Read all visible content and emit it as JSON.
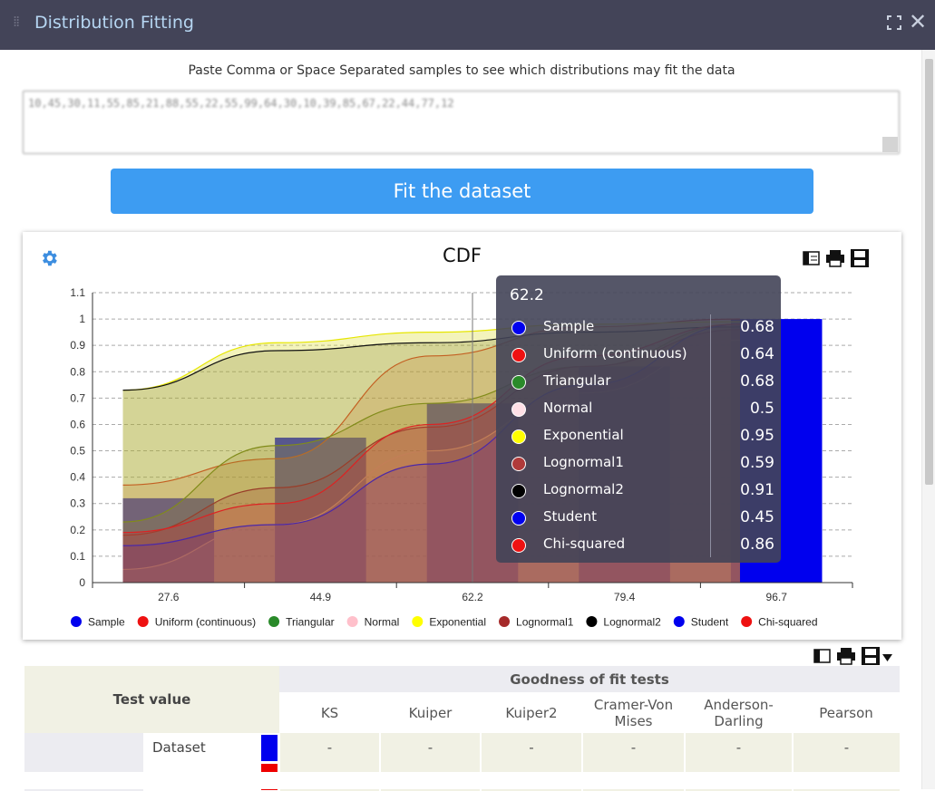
{
  "window": {
    "title": "Distribution Fitting"
  },
  "instruction": "Paste Comma or Space Separated samples to see which distributions may fit the data",
  "samples_text": "10,45,30,11,55,85,21,88,55,22,55,99,64,30,10,39,85,67,22,44,77,12",
  "fit_button": "Fit the dataset",
  "chart_data": {
    "type": "bar",
    "title": "CDF",
    "x_ticks": [
      27.6,
      44.9,
      62.2,
      79.4,
      96.7
    ],
    "ylim": [
      0,
      1.1
    ],
    "y_ticks": [
      "0",
      "0.1",
      "0.2",
      "0.3",
      "0.4",
      "0.5",
      "0.6",
      "0.7",
      "0.8",
      "0.9",
      "1",
      "1.1"
    ],
    "grid": true,
    "legend_position": "bottom",
    "bars": {
      "name": "Sample",
      "values": [
        0.32,
        0.55,
        0.68,
        0.82,
        1.0
      ]
    },
    "series": [
      {
        "name": "Sample",
        "color": "#0000ee",
        "values": [
          0.32,
          0.55,
          0.68,
          0.82,
          1.0
        ]
      },
      {
        "name": "Uniform (continuous)",
        "color": "#ee1111",
        "values": [
          0.37,
          0.47,
          0.86,
          0.97,
          1.0
        ]
      },
      {
        "name": "Triangular",
        "color": "#2a8a2a",
        "values": [
          0.23,
          0.52,
          0.68,
          0.82,
          0.98
        ]
      },
      {
        "name": "Normal",
        "color": "#ffc0cb",
        "values": [
          0.05,
          0.22,
          0.5,
          0.72,
          0.92
        ]
      },
      {
        "name": "Exponential",
        "color": "#ffff00",
        "values": [
          0.73,
          0.91,
          0.95,
          0.98,
          0.99
        ]
      },
      {
        "name": "Lognormal1",
        "color": "#a52a2a",
        "values": [
          0.18,
          0.36,
          0.59,
          0.82,
          0.96
        ]
      },
      {
        "name": "Lognormal2",
        "color": "#000000",
        "values": [
          0.73,
          0.88,
          0.91,
          0.95,
          0.97
        ]
      },
      {
        "name": "Student",
        "color": "#0000ee",
        "values": [
          0.14,
          0.22,
          0.45,
          0.75,
          0.98
        ]
      },
      {
        "name": "Chi-squared",
        "color": "#ee1111",
        "values": [
          0.19,
          0.3,
          0.6,
          0.86,
          0.98
        ]
      }
    ]
  },
  "tooltip": {
    "header": "62.2",
    "rows": [
      {
        "name": "Sample",
        "value": "0.68"
      },
      {
        "name": "Uniform (continuous)",
        "value": "0.64"
      },
      {
        "name": "Triangular",
        "value": "0.68"
      },
      {
        "name": "Normal",
        "value": "0.5"
      },
      {
        "name": "Exponential",
        "value": "0.95"
      },
      {
        "name": "Lognormal1",
        "value": "0.59"
      },
      {
        "name": "Lognormal2",
        "value": "0.91"
      },
      {
        "name": "Student",
        "value": "0.45"
      },
      {
        "name": "Chi-squared",
        "value": "0.86"
      }
    ]
  },
  "table": {
    "test_value_header": "Test value",
    "gof_header": "Goodness of fit tests",
    "columns": [
      "KS",
      "Kuiper",
      "Kuiper2",
      "Cramer-Von Mises",
      "Anderson-Darling",
      "Pearson"
    ],
    "rows": [
      {
        "label": "Dataset",
        "swatch": "#0000ee",
        "cells": [
          "-",
          "-",
          "-",
          "-",
          "-",
          "-"
        ]
      }
    ],
    "next_row_swatch": "#ee0000"
  }
}
